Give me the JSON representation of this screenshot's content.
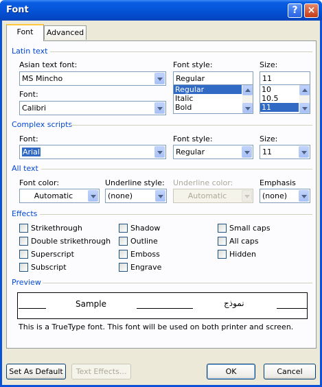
{
  "window": {
    "title": "Font",
    "help_glyph": "?",
    "close_glyph": "×"
  },
  "tabs": [
    {
      "label": "Font",
      "accel": "n"
    },
    {
      "label": "Advanced",
      "accel": "v"
    }
  ],
  "latin": {
    "section": "Latin text",
    "asian_label": "Asian text font:",
    "asian_value": "MS Mincho",
    "font_label": "Font:",
    "font_value": "Calibri",
    "style_label": "Font style:",
    "style_value": "Regular",
    "style_options": [
      "Regular",
      "Italic",
      "Bold"
    ],
    "size_label": "Size:",
    "size_value": "11",
    "size_options": [
      "10",
      "10.5",
      "11"
    ]
  },
  "complex": {
    "section": "Complex scripts",
    "font_label": "Font:",
    "font_value": "Arial",
    "style_label": "Font style:",
    "style_value": "Regular",
    "size_label": "Size:",
    "size_value": "11"
  },
  "alltext": {
    "section": "All text",
    "color_label": "Font color:",
    "color_value": "Automatic",
    "underline_label": "Underline style:",
    "underline_value": "(none)",
    "ucolor_label": "Underline color:",
    "ucolor_value": "Automatic",
    "emphasis_label": "Emphasis mark:",
    "emphasis_value": "(none)"
  },
  "effects": {
    "section": "Effects",
    "items": [
      "Strikethrough",
      "Double strikethrough",
      "Superscript",
      "Subscript",
      "Shadow",
      "Outline",
      "Emboss",
      "Engrave",
      "Small caps",
      "All caps",
      "Hidden"
    ]
  },
  "preview": {
    "section": "Preview",
    "sample": "Sample",
    "arabic_sample": "نموذج",
    "note": "This is a TrueType font. This font will be used on both printer and screen."
  },
  "buttons": {
    "default": "Set As Default",
    "text_effects": "Text Effects...",
    "ok": "OK",
    "cancel": "Cancel"
  }
}
